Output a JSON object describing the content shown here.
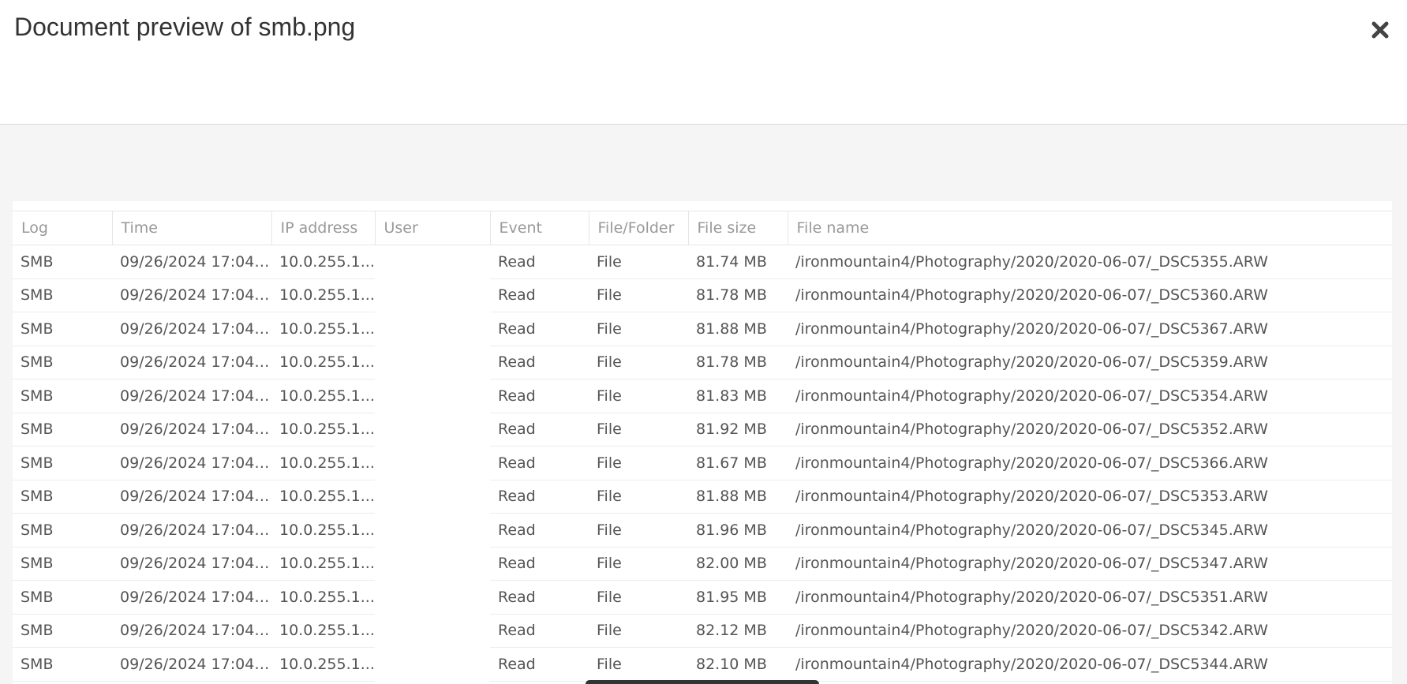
{
  "dialog": {
    "title": "Document preview of smb.png",
    "close_icon": "close-icon"
  },
  "table": {
    "columns": [
      "Log",
      "Time",
      "IP address",
      "User",
      "Event",
      "File/Folder",
      "File size",
      "File name"
    ],
    "rows": [
      {
        "log": "SMB",
        "time": "09/26/2024 17:04:...",
        "ip": "10.0.255.1...",
        "user": "",
        "event": "Read",
        "type": "File",
        "size": "81.74 MB",
        "name": "/ironmountain4/Photography/2020/2020-06-07/_DSC5355.ARW"
      },
      {
        "log": "SMB",
        "time": "09/26/2024 17:04:...",
        "ip": "10.0.255.1...",
        "user": "",
        "event": "Read",
        "type": "File",
        "size": "81.78 MB",
        "name": "/ironmountain4/Photography/2020/2020-06-07/_DSC5360.ARW"
      },
      {
        "log": "SMB",
        "time": "09/26/2024 17:04:...",
        "ip": "10.0.255.1...",
        "user": "",
        "event": "Read",
        "type": "File",
        "size": "81.88 MB",
        "name": "/ironmountain4/Photography/2020/2020-06-07/_DSC5367.ARW"
      },
      {
        "log": "SMB",
        "time": "09/26/2024 17:04:...",
        "ip": "10.0.255.1...",
        "user": "",
        "event": "Read",
        "type": "File",
        "size": "81.78 MB",
        "name": "/ironmountain4/Photography/2020/2020-06-07/_DSC5359.ARW"
      },
      {
        "log": "SMB",
        "time": "09/26/2024 17:04:...",
        "ip": "10.0.255.1...",
        "user": "",
        "event": "Read",
        "type": "File",
        "size": "81.83 MB",
        "name": "/ironmountain4/Photography/2020/2020-06-07/_DSC5354.ARW"
      },
      {
        "log": "SMB",
        "time": "09/26/2024 17:04:...",
        "ip": "10.0.255.1...",
        "user": "",
        "event": "Read",
        "type": "File",
        "size": "81.92 MB",
        "name": "/ironmountain4/Photography/2020/2020-06-07/_DSC5352.ARW"
      },
      {
        "log": "SMB",
        "time": "09/26/2024 17:04:...",
        "ip": "10.0.255.1...",
        "user": "",
        "event": "Read",
        "type": "File",
        "size": "81.67 MB",
        "name": "/ironmountain4/Photography/2020/2020-06-07/_DSC5366.ARW"
      },
      {
        "log": "SMB",
        "time": "09/26/2024 17:04:...",
        "ip": "10.0.255.1...",
        "user": "",
        "event": "Read",
        "type": "File",
        "size": "81.88 MB",
        "name": "/ironmountain4/Photography/2020/2020-06-07/_DSC5353.ARW"
      },
      {
        "log": "SMB",
        "time": "09/26/2024 17:04:...",
        "ip": "10.0.255.1...",
        "user": "",
        "event": "Read",
        "type": "File",
        "size": "81.96 MB",
        "name": "/ironmountain4/Photography/2020/2020-06-07/_DSC5345.ARW"
      },
      {
        "log": "SMB",
        "time": "09/26/2024 17:04:...",
        "ip": "10.0.255.1...",
        "user": "",
        "event": "Read",
        "type": "File",
        "size": "82.00 MB",
        "name": "/ironmountain4/Photography/2020/2020-06-07/_DSC5347.ARW"
      },
      {
        "log": "SMB",
        "time": "09/26/2024 17:04:...",
        "ip": "10.0.255.1...",
        "user": "",
        "event": "Read",
        "type": "File",
        "size": "81.95 MB",
        "name": "/ironmountain4/Photography/2020/2020-06-07/_DSC5351.ARW"
      },
      {
        "log": "SMB",
        "time": "09/26/2024 17:04:...",
        "ip": "10.0.255.1...",
        "user": "",
        "event": "Read",
        "type": "File",
        "size": "82.12 MB",
        "name": "/ironmountain4/Photography/2020/2020-06-07/_DSC5342.ARW"
      },
      {
        "log": "SMB",
        "time": "09/26/2024 17:04:...",
        "ip": "10.0.255.1...",
        "user": "",
        "event": "Read",
        "type": "File",
        "size": "82.10 MB",
        "name": "/ironmountain4/Photography/2020/2020-06-07/_DSC5344.ARW"
      }
    ]
  }
}
